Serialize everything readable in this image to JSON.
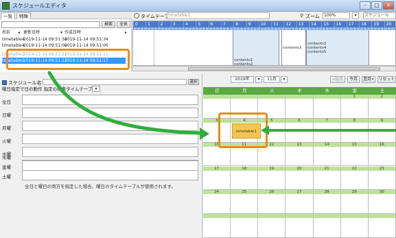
{
  "window": {
    "title": "スケジュールエディタ",
    "min": "–",
    "max": "□",
    "close": "×"
  },
  "list_panel": {
    "tabs": [
      "一覧",
      "特殊"
    ],
    "search_button": "検索",
    "all_button": "全体",
    "columns": [
      "名前",
      "更新日時",
      "作成日時"
    ],
    "rows": [
      {
        "name": "timetable4",
        "updated": "2019-11-14 09:51:34",
        "created": "2019-11-14 09:51:34"
      },
      {
        "name": "timetable4",
        "updated": "2019-11-14 09:51:00",
        "created": "2019-11-14 09:51:00"
      },
      {
        "name": "timetable2",
        "updated": "2019-11-14 09:51:21",
        "created": "2019-11-14 09:51:21"
      },
      {
        "name": "timetable1",
        "updated": "2019-11-14 09:51:17",
        "created": "2019-11-14 09:51:17"
      }
    ]
  },
  "schedule_form": {
    "name_label": "スケジュール名",
    "select_button": "選択",
    "weekday_default_label": "曜日指定で日の動作",
    "weekday_default_value": "指定の標準タイムテーブル",
    "days": [
      "全日",
      "日曜",
      "月曜",
      "火曜",
      "水曜",
      "木曜",
      "金曜",
      "土曜"
    ],
    "note": "全日と曜日の両方を指定した場合、曜日のタイムテーブルが使用されます。"
  },
  "timeline": {
    "label": "タイムテーブル名",
    "name_value": "timetable1",
    "zoom_label": "ズーム",
    "zoom_value": "100%",
    "schedule_dropdown": "スケジュール",
    "hours": [
      "0",
      "1",
      "2",
      "3",
      "4",
      "5",
      "6",
      "7",
      "8",
      "9",
      "10",
      "11",
      "12",
      "13",
      "14",
      "15",
      "16",
      "17",
      "18",
      "19",
      "20"
    ],
    "blocks": [
      {
        "lines": [
          "contents1",
          "contents2"
        ]
      },
      {
        "lines": [
          "contents3"
        ]
      },
      {
        "lines": [
          "contents3",
          "contents4",
          "contents5"
        ]
      }
    ]
  },
  "calendar": {
    "year": "2019年",
    "month": "11月",
    "prev": "前月",
    "this": "今月",
    "next": "翌月",
    "reset": "リセット",
    "dow": [
      "日",
      "月",
      "火",
      "水",
      "木",
      "金",
      "土"
    ],
    "weeks": [
      [
        "",
        "",
        "",
        "",
        "",
        "1",
        "2"
      ],
      [
        "3",
        "4",
        "5",
        "6",
        "7",
        "8",
        "9"
      ],
      [
        "10",
        "11",
        "12",
        "13",
        "14",
        "15",
        "16"
      ],
      [
        "17",
        "18",
        "19",
        "20",
        "21",
        "22",
        "23"
      ],
      [
        "24",
        "25",
        "26",
        "27",
        "28",
        "29",
        "30"
      ],
      [
        "",
        "",
        "",
        "",
        "",
        "",
        ""
      ]
    ],
    "event": {
      "label": "timetable1",
      "day": "4"
    }
  },
  "colors": {
    "accent_callout": "#ea8a10",
    "arrow": "#2fae3c",
    "calendar_header": "#5aa842",
    "event": "#f5c64e",
    "selection": "#3399ff"
  }
}
